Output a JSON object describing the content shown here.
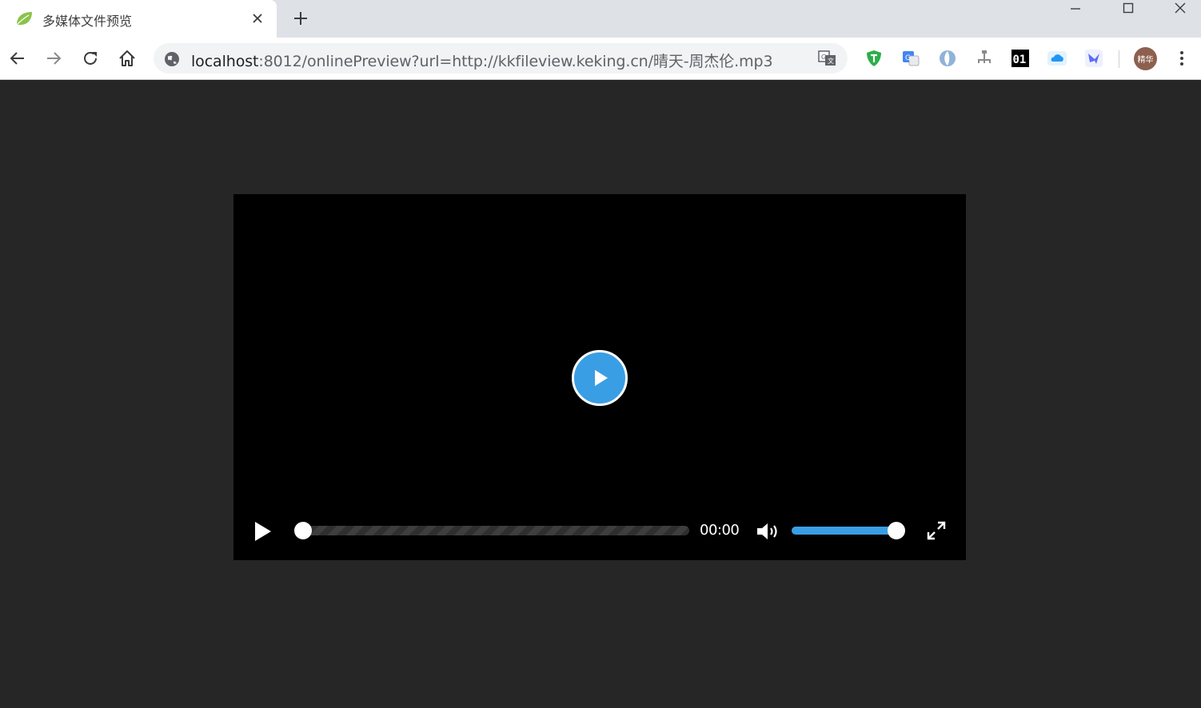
{
  "browser": {
    "tab": {
      "title": "多媒体文件预览",
      "favicon": "spring-leaf-icon"
    },
    "address": {
      "host": "localhost",
      "rest": ":8012/onlinePreview?url=http://kkfileview.keking.cn/晴天-周杰伦.mp3"
    },
    "profile": {
      "label": "精华"
    },
    "extensions": [
      "adguard-shield-icon",
      "google-translate-icon",
      "circle-logo-icon",
      "tree-network-icon",
      "binary-01-icon",
      "cloud-icon",
      "bird-logo-icon"
    ]
  },
  "player": {
    "time": "00:00",
    "progress": 0.0,
    "volume": 1.0
  },
  "colors": {
    "accent": "#3a9ee4",
    "page_bg": "#262626",
    "player_bg": "#000000"
  }
}
